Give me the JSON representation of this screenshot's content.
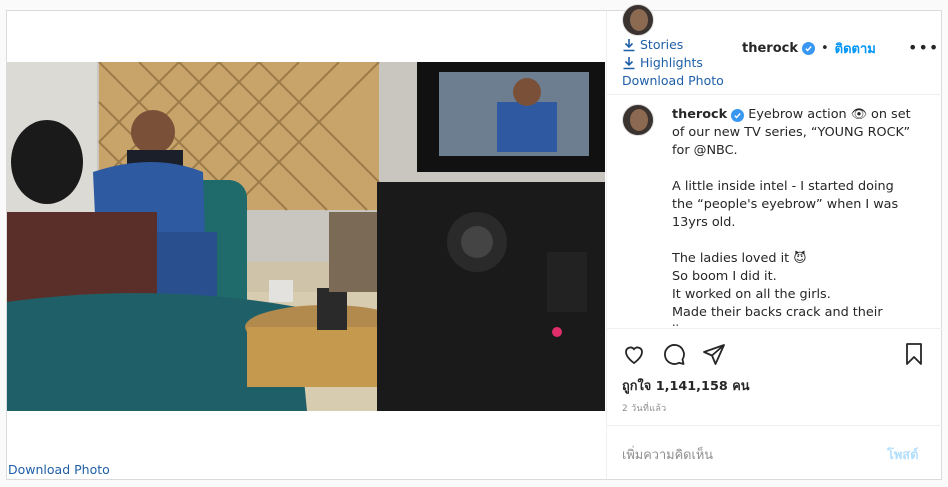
{
  "post_image": {
    "alt": "",
    "download_label": "Download Photo"
  },
  "overlay": {
    "stories_label": "Stories",
    "highlights_label": "Highlights",
    "download_label": "Download Photo"
  },
  "header": {
    "username": "therock",
    "separator": "•",
    "follow_label": "ติดตาม",
    "more_label": "•••"
  },
  "caption": {
    "username": "therock",
    "first_line": "Eyebrow action 👁 on set of our new TV series, “YOUNG ROCK” for @NBC.",
    "paragraph_2": "A little inside intel - I started doing the “people's eyebrow” when I was 13yrs old.",
    "lines": [
      "The ladies loved it 😈",
      "So boom I did it.",
      "It worked on all the girls.",
      "Made their backs crack and their livers"
    ]
  },
  "likes": {
    "text": "ถูกใจ 1,141,158 คน"
  },
  "posted": {
    "text": "2 วันที่แล้ว"
  },
  "comment": {
    "placeholder": "เพิ่มความคิดเห็น",
    "post_label": "โพสต์"
  },
  "colors": {
    "link": "#1f5fa8",
    "follow": "#0095f6",
    "verified": "#3897f0",
    "muted": "#8e8e8e"
  }
}
